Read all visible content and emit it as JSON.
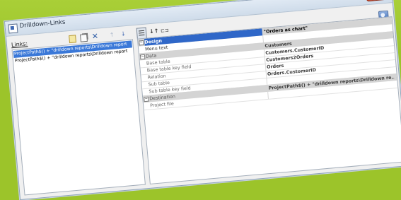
{
  "window": {
    "title": "Drilldown-Links",
    "close_glyph": "✕"
  },
  "links_panel": {
    "label": "Links:",
    "items": [
      "ProjectPath$() + \"drilldown reports\\Drilldown report",
      "ProjectPath$() + \"drilldown reports\\Drilldown report"
    ],
    "selected_index": 0
  },
  "toolbar": {
    "delete_glyph": "✕",
    "up_glyph": "↑",
    "down_glyph": "↓",
    "sort_glyph": "↓↑",
    "events_glyph": "⊏⊐"
  },
  "properties": [
    {
      "type": "category",
      "name": "Design",
      "value": "\"Orders as chart\"",
      "selected": true
    },
    {
      "type": "prop",
      "name": "Menu text",
      "value": ""
    },
    {
      "type": "category",
      "name": "Data",
      "value": "Customers"
    },
    {
      "type": "prop",
      "name": "Base table",
      "value": "Customers.CustomerID"
    },
    {
      "type": "prop",
      "name": "Base table key field",
      "value": "Customers2Orders"
    },
    {
      "type": "prop",
      "name": "Relation",
      "value": "Orders"
    },
    {
      "type": "prop",
      "name": "Sub table",
      "value": "Orders.CustomerID"
    },
    {
      "type": "prop",
      "name": "Sub table key field",
      "value": ""
    },
    {
      "type": "category",
      "name": "Destination",
      "value": "ProjectPath$() + \"drilldown reports\\Drilldown re..."
    },
    {
      "type": "prop",
      "name": "Project file",
      "value": ""
    }
  ],
  "icons": {
    "app": "window-app-icon",
    "help": "help-icon",
    "new": "new-link-icon",
    "copy": "copy-link-icon",
    "delete": "delete-link-icon",
    "up": "move-up-icon",
    "down": "move-down-icon",
    "categorized": "categorized-view-icon",
    "sort": "alphabetical-sort-icon",
    "events": "events-icon"
  },
  "colors": {
    "background": "#9cc42a",
    "selection": "#3a78d8",
    "category_row": "#d4d4d4",
    "close_button": "#c43f21"
  }
}
